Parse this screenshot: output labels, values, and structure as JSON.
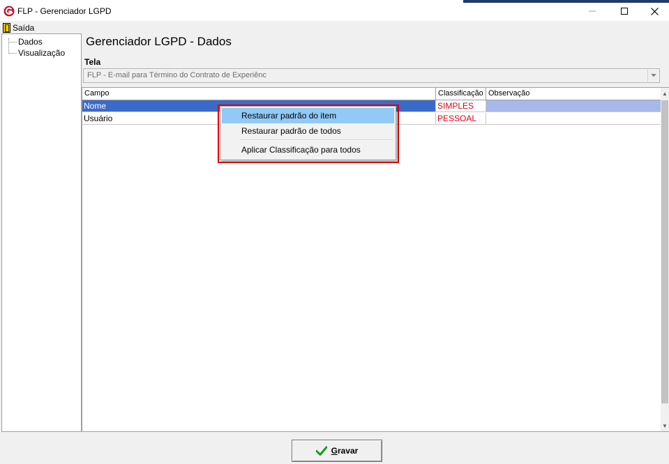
{
  "window": {
    "title": "FLP - Gerenciador LGPD",
    "accent_color": "#c8102e"
  },
  "menubar": {
    "exit_label": "Saída"
  },
  "sidebar": {
    "items": [
      {
        "label": "Dados"
      },
      {
        "label": "Visualização"
      }
    ]
  },
  "main": {
    "title": "Gerenciador LGPD - Dados",
    "tela_label": "Tela",
    "tela_select": {
      "value": "FLP - E-mail para Término do Contrato de Experiênc"
    },
    "grid": {
      "columns": [
        "Campo",
        "Classificação",
        "Observação"
      ],
      "rows": [
        {
          "campo": "Nome",
          "classificacao": "SIMPLES",
          "observacao": "",
          "selected": true
        },
        {
          "campo": "Usuário",
          "classificacao": "PESSOAL",
          "observacao": "",
          "selected": false
        }
      ],
      "classification_color": "#e0001a",
      "selection_color": "#3b6bc9"
    }
  },
  "context_menu": {
    "items": [
      {
        "label": "Restaurar padrão do item",
        "highlighted": true
      },
      {
        "label": "Restaurar padrão de todos",
        "highlighted": false
      },
      {
        "label": "Aplicar Classificação para todos",
        "highlighted": false
      }
    ],
    "outline_color": "#e00000"
  },
  "footer": {
    "save_label_underlined": "G",
    "save_label_rest": "ravar",
    "save_icon": "checkmark-icon"
  }
}
